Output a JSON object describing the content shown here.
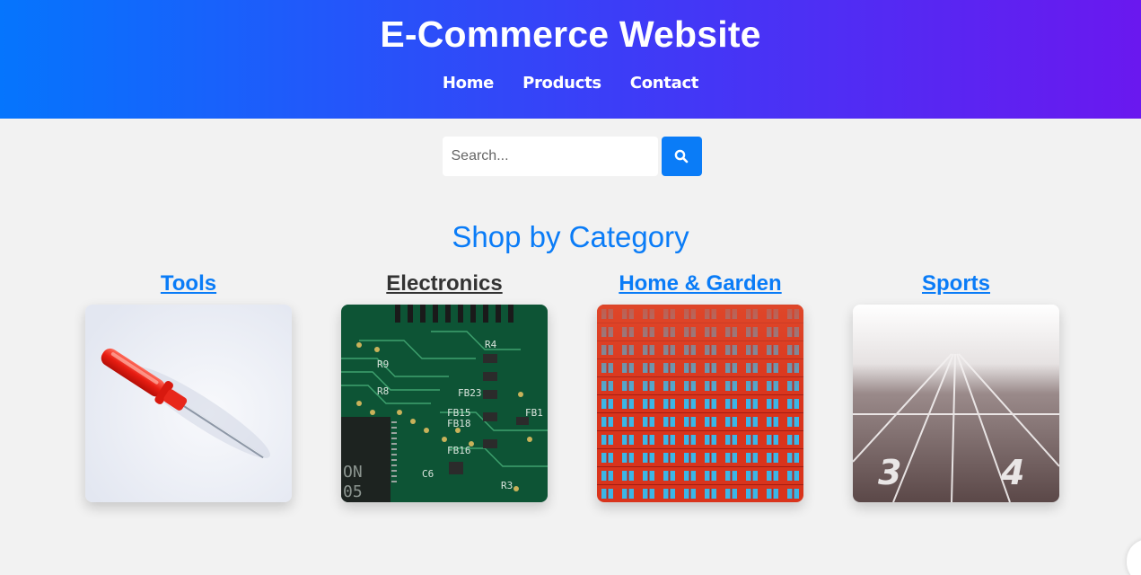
{
  "header": {
    "title": "E-Commerce Website",
    "nav": [
      "Home",
      "Products",
      "Contact"
    ]
  },
  "search": {
    "placeholder": "Search...",
    "value": "",
    "button_icon": "search-icon"
  },
  "section": {
    "title": "Shop by Category"
  },
  "categories": [
    {
      "label": "Tools",
      "image": "red-screwdriver"
    },
    {
      "label": "Electronics",
      "image": "circuit-board"
    },
    {
      "label": "Home & Garden",
      "image": "red-building-facade"
    },
    {
      "label": "Sports",
      "image": "running-track"
    }
  ],
  "circuit_text": {
    "fb23": "FB23",
    "fb15": "FB15",
    "fb18": "FB18",
    "fb16": "FB16",
    "fb1": "FB1",
    "on": "ON",
    "o5": "05",
    "c6": "C6",
    "r9": "R9",
    "r8": "R8",
    "r4": "R4",
    "r3": "R3"
  },
  "track_numbers": {
    "lane3": "3",
    "lane4": "4"
  },
  "colors": {
    "accent": "#0a7cf7",
    "header_start": "#0575fd",
    "header_end": "#6a18ef",
    "active_category": "#333333"
  }
}
